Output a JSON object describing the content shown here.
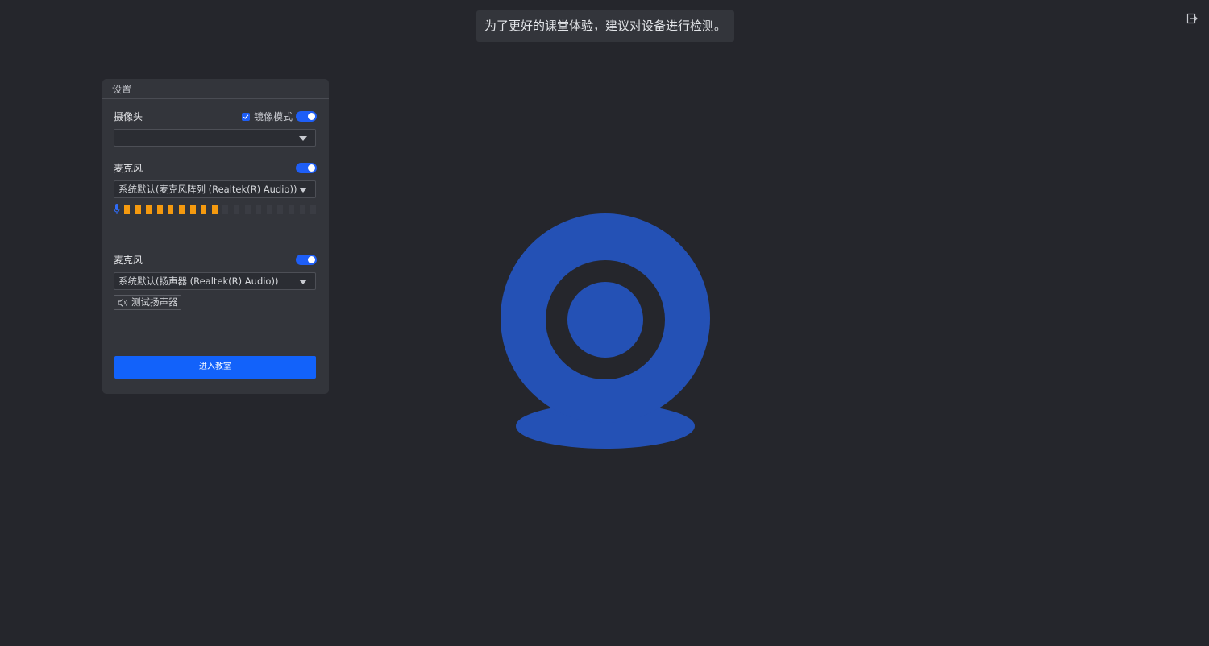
{
  "notice": {
    "text": "为了更好的课堂体验，建议对设备进行检测。"
  },
  "settings_panel": {
    "title": "设置",
    "camera": {
      "label": "摄像头",
      "mirror_label": "镜像模式",
      "mirror_checked": true,
      "enabled": true,
      "selected_device": ""
    },
    "microphone": {
      "label": "麦克风",
      "enabled": true,
      "selected_device": "系统默认(麦克风阵列 (Realtek(R) Audio))",
      "level": {
        "active_bars": 9,
        "total_bars": 18
      }
    },
    "speaker": {
      "label": "麦克风",
      "enabled": true,
      "selected_device": "系统默认(扬声器 (Realtek(R) Audio))",
      "test_button_label": "测试扬声器"
    },
    "enter_button_label": "进入教室"
  },
  "colors": {
    "background": "#25262c",
    "panel": "#33353b",
    "accent": "#1262fa",
    "meter_active": "#f59a0f",
    "illustration": "#2451b5"
  },
  "icons": {
    "exit": "exit-icon",
    "check": "check-icon",
    "dropdown": "chevron-down-icon",
    "mic": "mic-icon",
    "speaker": "speaker-icon",
    "camera_illustration": "webcam-icon"
  }
}
